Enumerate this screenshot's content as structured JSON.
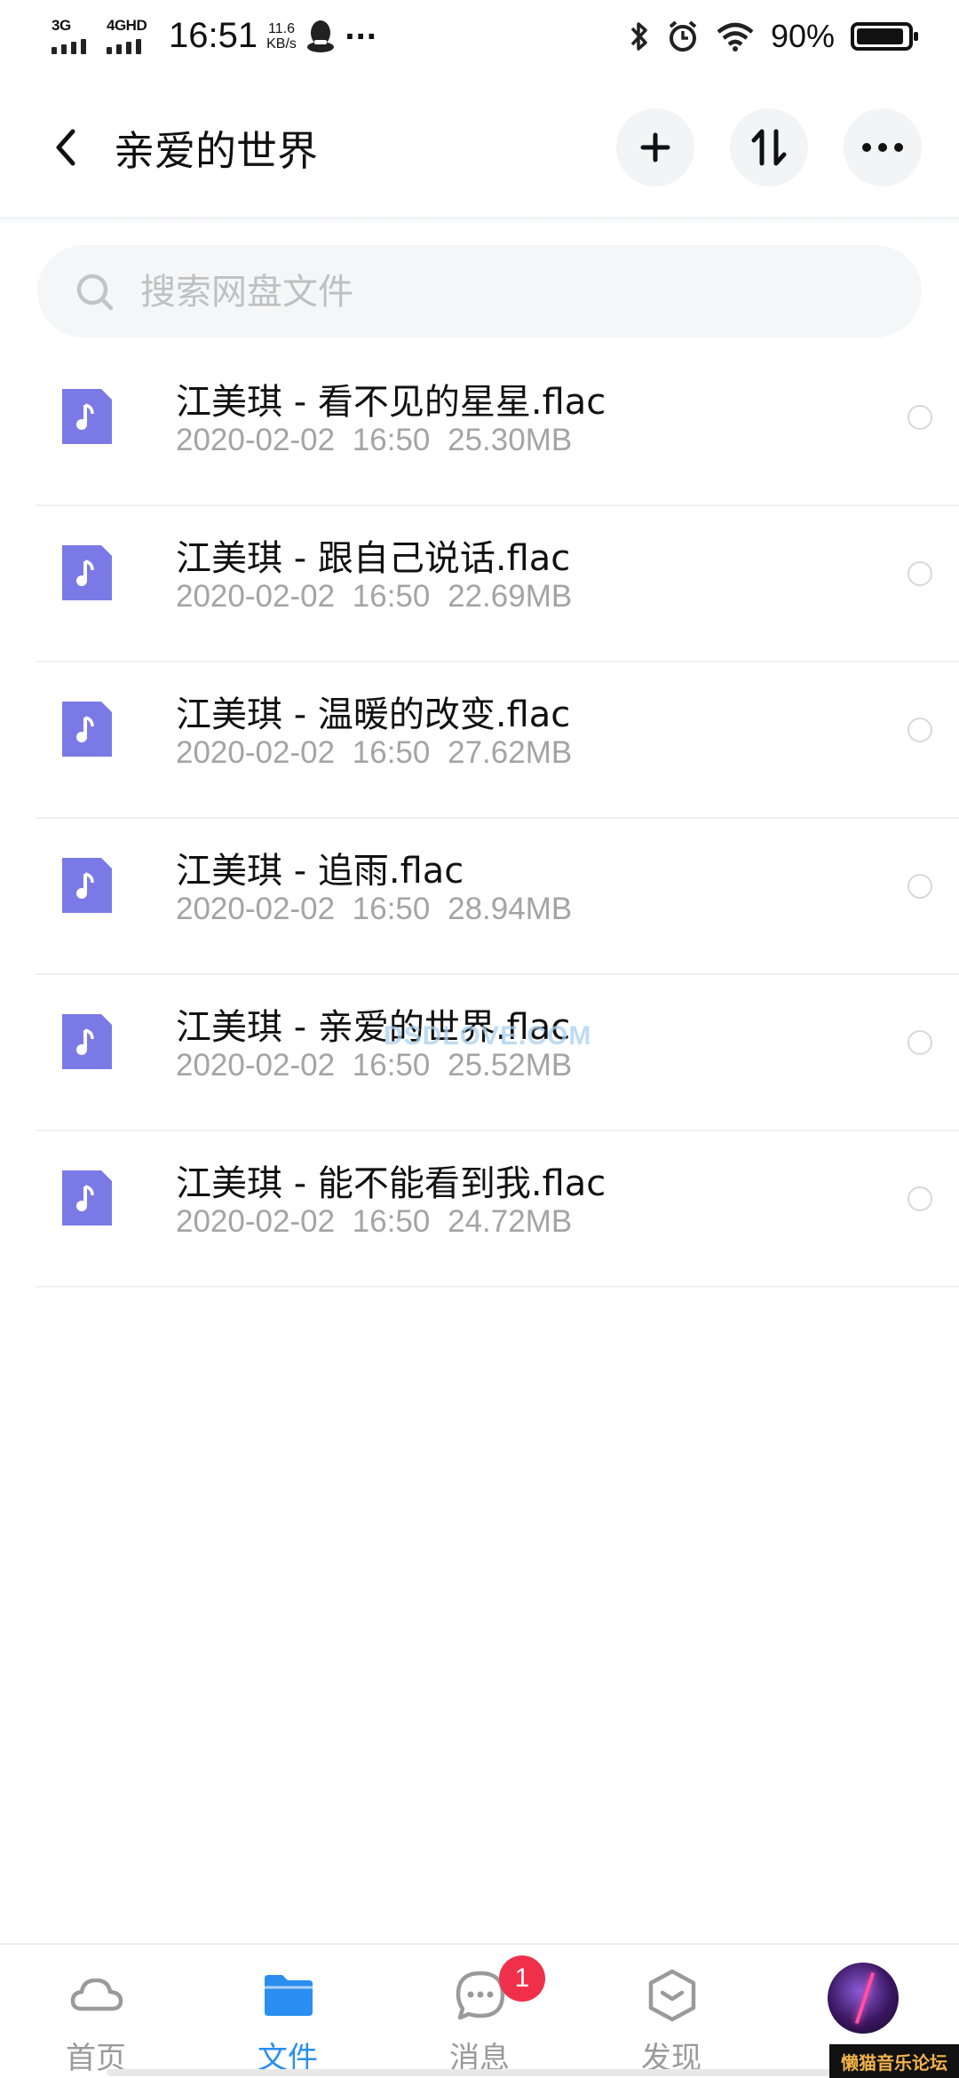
{
  "status_bar": {
    "signal1": "3G",
    "signal2": "4GHD",
    "time": "16:51",
    "speed_value": "11.6",
    "speed_unit": "KB/s",
    "more": "···",
    "battery": "90%"
  },
  "header": {
    "title": "亲爱的世界"
  },
  "search": {
    "placeholder": "搜索网盘文件"
  },
  "files": [
    {
      "name": "江美琪 - 看不见的星星.flac",
      "date": "2020-02-02",
      "time": "16:50",
      "size": "25.30MB"
    },
    {
      "name": "江美琪 - 跟自己说话.flac",
      "date": "2020-02-02",
      "time": "16:50",
      "size": "22.69MB"
    },
    {
      "name": "江美琪 - 温暖的改变.flac",
      "date": "2020-02-02",
      "time": "16:50",
      "size": "27.62MB"
    },
    {
      "name": "江美琪 - 追雨.flac",
      "date": "2020-02-02",
      "time": "16:50",
      "size": "28.94MB"
    },
    {
      "name": "江美琪 - 亲爱的世界.flac",
      "date": "2020-02-02",
      "time": "16:50",
      "size": "25.52MB"
    },
    {
      "name": "江美琪 - 能不能看到我.flac",
      "date": "2020-02-02",
      "time": "16:50",
      "size": "24.72MB"
    }
  ],
  "watermark": "DSDLOVE.COM",
  "bottom_nav": {
    "items": [
      {
        "label": "首页",
        "icon": "cloud-icon"
      },
      {
        "label": "文件",
        "icon": "folder-icon"
      },
      {
        "label": "消息",
        "icon": "message-icon"
      },
      {
        "label": "发现",
        "icon": "discover-icon"
      }
    ],
    "badge": "1",
    "active_color": "#2a8ef0"
  },
  "corner_stamp": "懒猫音乐论坛",
  "colors": {
    "file_icon": "#7b79e6",
    "accent": "#2a8ef0",
    "badge": "#f0304a"
  }
}
